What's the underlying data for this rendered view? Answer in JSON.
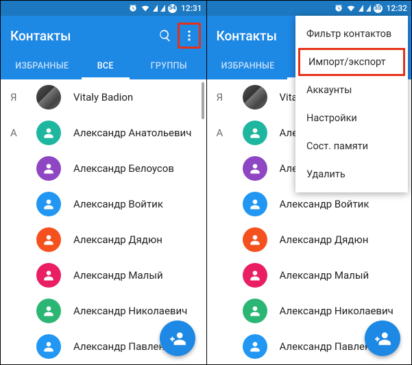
{
  "left": {
    "status": {
      "battery": "54",
      "time": "12:31"
    },
    "header": {
      "title": "Контакты"
    },
    "tabs": [
      {
        "label": "ИЗБРАННЫЕ",
        "active": false
      },
      {
        "label": "ВСЕ",
        "active": true
      },
      {
        "label": "ГРУППЫ",
        "active": false
      }
    ],
    "sections": [
      {
        "letter": "Я",
        "items": [
          {
            "name": "Vitaly Badion",
            "avatar": "image"
          }
        ]
      },
      {
        "letter": "А",
        "items": [
          {
            "name": "Александр Анатольевич",
            "avatar_color": "#1fb6a0"
          },
          {
            "name": "Александр Белоусов",
            "avatar_color": "#8e46c3"
          },
          {
            "name": "Александр Войтик",
            "avatar_color": "#2196f3"
          },
          {
            "name": "Александр Дядюн",
            "avatar_color": "#f4511e"
          },
          {
            "name": "Александр Малый",
            "avatar_color": "#e91e63"
          },
          {
            "name": "Александр Николаевич",
            "avatar_color": "#2bb673"
          },
          {
            "name": "Александр Павленко",
            "avatar_color": "#2196f3"
          }
        ]
      }
    ]
  },
  "right": {
    "status": {
      "battery": "55",
      "time": "12:32"
    },
    "header": {
      "title": "Контакты"
    },
    "tabs": [
      {
        "label": "ИЗБРАННЫЕ",
        "active": false
      },
      {
        "label": "ВСЕ",
        "active": true
      },
      {
        "label": "ГРУППЫ",
        "active": false
      }
    ],
    "sections": [
      {
        "letter": "Я",
        "items": [
          {
            "name": "Vitaly",
            "avatar": "image"
          }
        ]
      },
      {
        "letter": "А",
        "items": [
          {
            "name": "Александр Анатольевич",
            "avatar_color": "#1fb6a0"
          },
          {
            "name": "Александр Белоусов",
            "avatar_color": "#8e46c3"
          },
          {
            "name": "Александр Войтик",
            "avatar_color": "#2196f3"
          },
          {
            "name": "Александр Дядюн",
            "avatar_color": "#f4511e"
          },
          {
            "name": "Александр Малый",
            "avatar_color": "#e91e63"
          },
          {
            "name": "Александр Николаевич",
            "avatar_color": "#2bb673"
          },
          {
            "name": "Александр Павленко",
            "avatar_color": "#2196f3"
          }
        ]
      }
    ],
    "menu": [
      {
        "label": "Фильтр контактов",
        "hl": false
      },
      {
        "label": "Импорт/экспорт",
        "hl": true
      },
      {
        "label": "Аккаунты",
        "hl": false
      },
      {
        "label": "Настройки",
        "hl": false
      },
      {
        "label": "Сост. памяти",
        "hl": false
      },
      {
        "label": "Удалить",
        "hl": false
      }
    ]
  }
}
